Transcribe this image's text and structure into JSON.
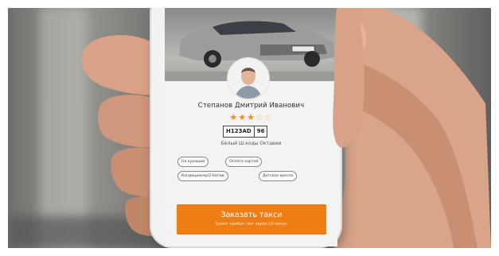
{
  "driver": {
    "name": "Степанов Дмитрий Иванович",
    "rating_stars": 3,
    "rating_max": 5,
    "plate_number": "H123AD",
    "plate_region": "96"
  },
  "car": {
    "description": "Белый Ш.коды Октавии"
  },
  "tags": [
    "На курящий",
    "Оплата картой",
    "Кондиционер/2-багаж",
    "Детское кресло"
  ],
  "order": {
    "label": "Заказать такси",
    "eta": "Бумат прибыт пит через 10 минут"
  },
  "colors": {
    "accent": "#f07d14",
    "star": "#f08c1a"
  }
}
